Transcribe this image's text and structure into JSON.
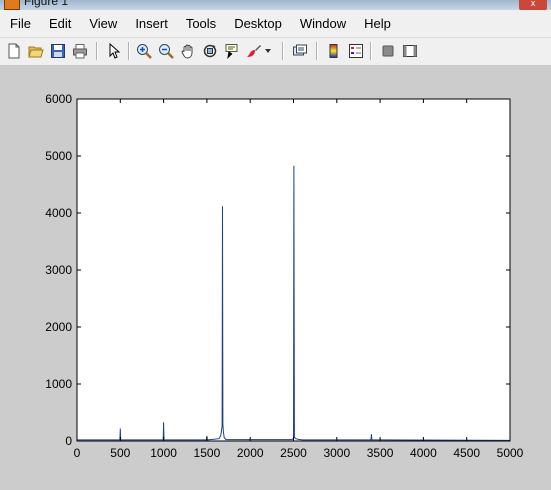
{
  "window": {
    "title": "Figure 1",
    "close_label": "x"
  },
  "menu": {
    "items": [
      "File",
      "Edit",
      "View",
      "Insert",
      "Tools",
      "Desktop",
      "Window",
      "Help"
    ]
  },
  "toolbar": {
    "buttons": [
      "new-figure-icon",
      "open-file-icon",
      "save-icon",
      "print-icon",
      "edit-plot-arrow-icon",
      "zoom-in-icon",
      "zoom-out-icon",
      "pan-hand-icon",
      "rotate-3d-icon",
      "data-cursor-icon",
      "brush-icon",
      "brush-dropdown-icon",
      "link-plot-icon",
      "insert-colorbar-icon",
      "insert-legend-icon",
      "hide-plot-tools-icon",
      "show-plot-tools-icon"
    ]
  },
  "colors": {
    "line": "#1f3f8f",
    "axes_bg": "#ffffff",
    "figure_bg": "#cccccc"
  },
  "chart_data": {
    "type": "line",
    "xlim": [
      0,
      5000
    ],
    "ylim": [
      0,
      6000
    ],
    "xticks": [
      0,
      500,
      1000,
      1500,
      2000,
      2500,
      3000,
      3500,
      4000,
      4500,
      5000
    ],
    "yticks": [
      0,
      1000,
      2000,
      3000,
      4000,
      5000,
      6000
    ],
    "grid": false,
    "series": [
      {
        "x": [
          0,
          495,
          500,
          505,
          995,
          1000,
          1005,
          1495,
          1500,
          1505,
          1640,
          1660,
          1675,
          1680,
          1685,
          1690,
          1700,
          1720,
          2480,
          2500,
          2505,
          2510,
          2530,
          2550,
          2600,
          3395,
          3400,
          3405,
          5000
        ],
        "y": [
          20,
          20,
          220,
          20,
          20,
          330,
          20,
          20,
          90,
          20,
          40,
          100,
          260,
          4120,
          290,
          160,
          60,
          25,
          25,
          40,
          4830,
          60,
          40,
          30,
          20,
          20,
          120,
          20,
          10
        ]
      }
    ]
  }
}
